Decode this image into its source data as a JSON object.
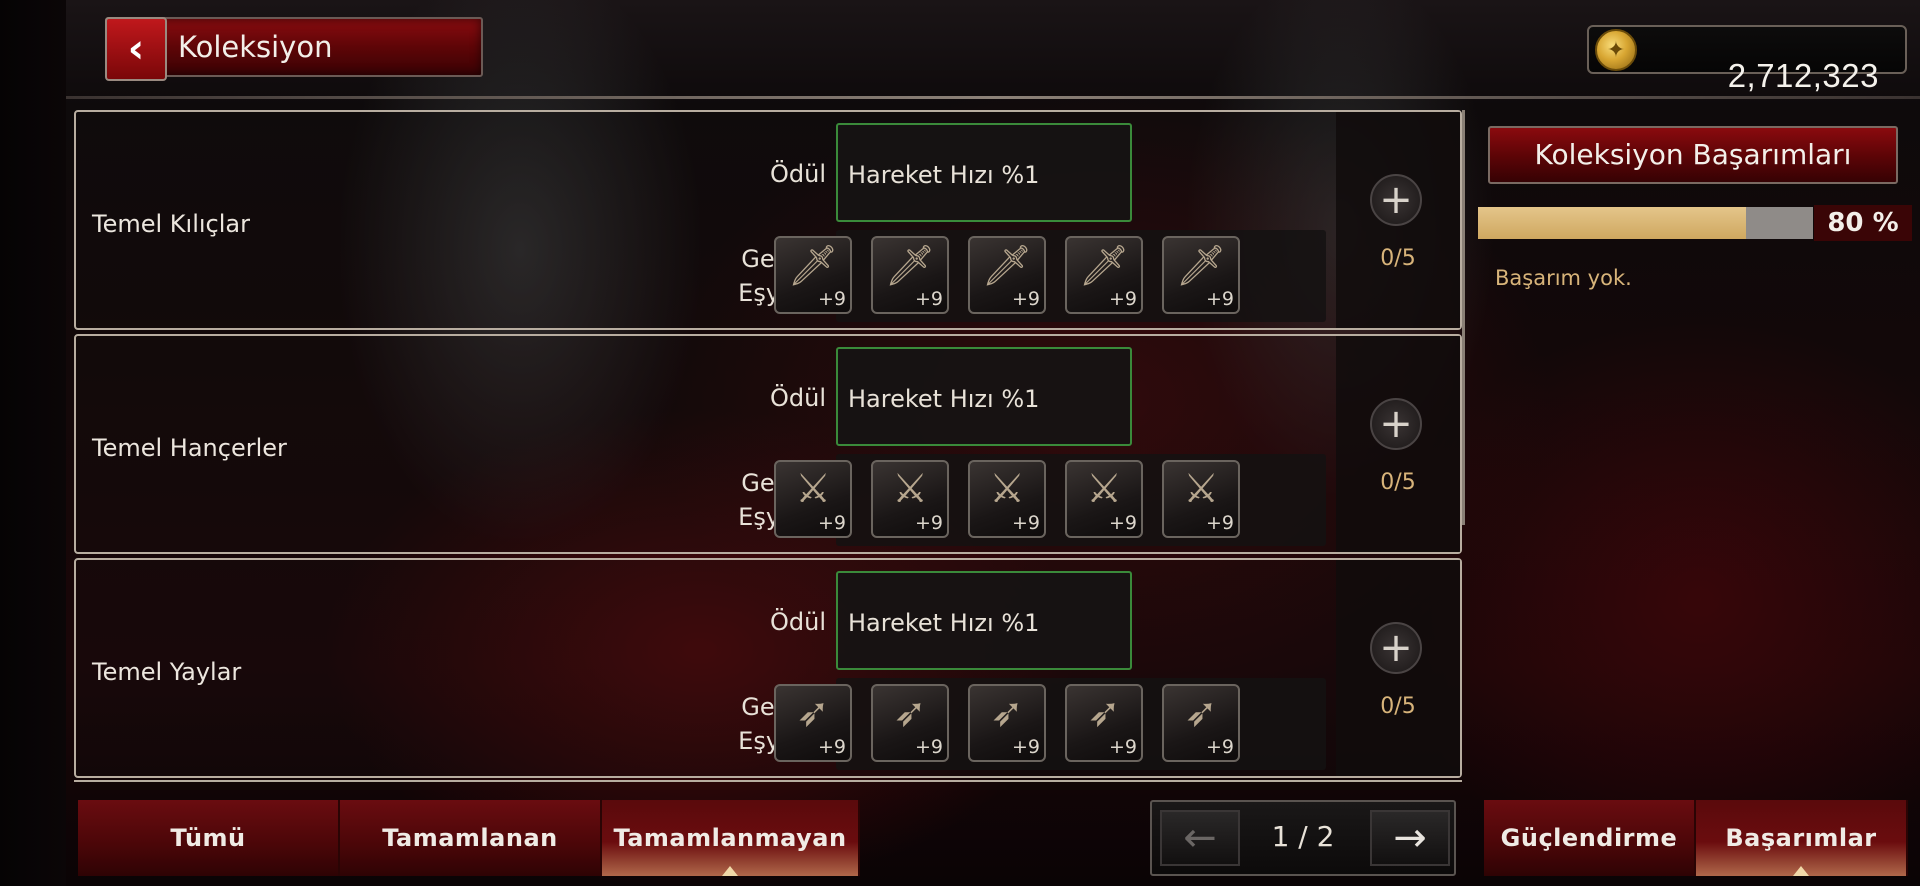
{
  "header": {
    "title": "Koleksiyon",
    "back_icon": "‹",
    "gold_amount": "2,712,323"
  },
  "collections": [
    {
      "name": "Temel Kılıçlar",
      "reward_label": "Ödül",
      "reward": "Hareket Hızı %1",
      "required_label_line1": "Gerekli",
      "required_label_line2": "Eşyalar",
      "items": [
        {
          "icon": "sword-icon",
          "level": "+9"
        },
        {
          "icon": "sword-icon",
          "level": "+9"
        },
        {
          "icon": "sword-icon",
          "level": "+9"
        },
        {
          "icon": "sword-icon",
          "level": "+9"
        },
        {
          "icon": "sword-icon",
          "level": "+9"
        }
      ],
      "count": "0/5"
    },
    {
      "name": "Temel Hançerler",
      "reward_label": "Ödül",
      "reward": "Hareket Hızı %1",
      "required_label_line1": "Gerekli",
      "required_label_line2": "Eşyalar",
      "items": [
        {
          "icon": "dagger-icon",
          "level": "+9"
        },
        {
          "icon": "dagger-icon",
          "level": "+9"
        },
        {
          "icon": "dagger-icon",
          "level": "+9"
        },
        {
          "icon": "dagger-icon",
          "level": "+9"
        },
        {
          "icon": "dagger-icon",
          "level": "+9"
        }
      ],
      "count": "0/5"
    },
    {
      "name": "Temel Yaylar",
      "reward_label": "Ödül",
      "reward": "Hareket Hızı %1",
      "required_label_line1": "Gerekli",
      "required_label_line2": "Eşyalar",
      "items": [
        {
          "icon": "bow-icon",
          "level": "+9"
        },
        {
          "icon": "bow-icon",
          "level": "+9"
        },
        {
          "icon": "bow-icon",
          "level": "+9"
        },
        {
          "icon": "bow-icon",
          "level": "+9"
        },
        {
          "icon": "bow-icon",
          "level": "+9"
        }
      ],
      "count": "0/5"
    }
  ],
  "achievements": {
    "title": "Koleksiyon Başarımları",
    "progress_percent": 80,
    "progress_label": "80 %",
    "empty_text": "Başarım yok."
  },
  "filter_tabs": [
    {
      "label": "Tümü",
      "active": false
    },
    {
      "label": "Tamamlanan",
      "active": false
    },
    {
      "label": "Tamamlanmayan",
      "active": true
    }
  ],
  "pagination": {
    "text": "1 / 2",
    "prev_icon": "←",
    "next_icon": "→"
  },
  "right_tabs": [
    {
      "label": "Güçlendirme",
      "active": false
    },
    {
      "label": "Başarımlar",
      "active": true
    }
  ],
  "colors": {
    "accent_red": "#8a0a0e",
    "reward_border": "#3a8a3a",
    "count_text": "#d8b47a",
    "progress_fill": "#e4c58a"
  }
}
